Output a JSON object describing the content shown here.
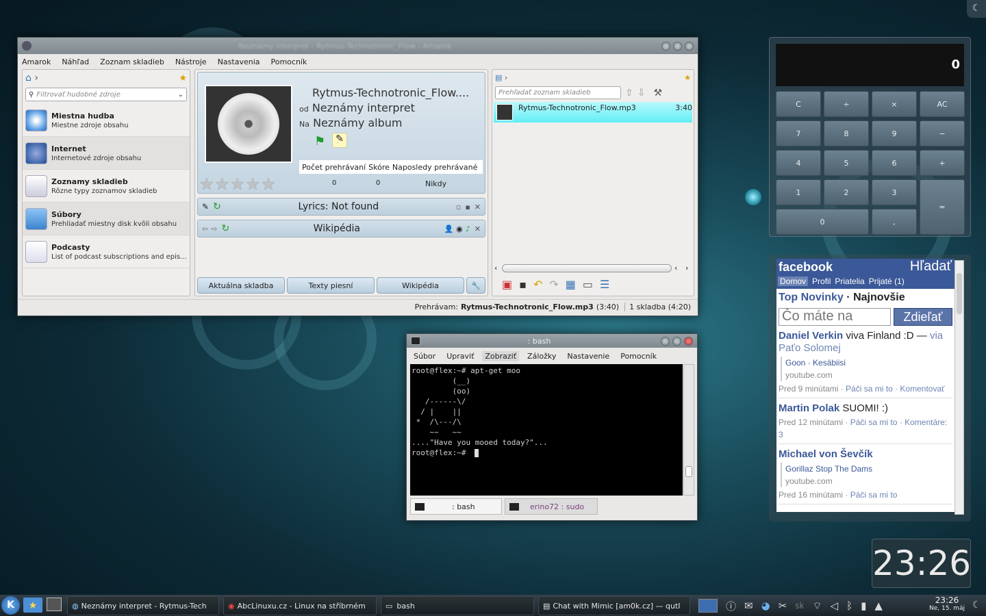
{
  "amarok": {
    "title": "Neznámy interpret - Rytmus-Technotronic_Flow - Amarok",
    "menu": [
      "Amarok",
      "Náhľad",
      "Zoznam skladieb",
      "Nástroje",
      "Nastavenia",
      "Pomocník"
    ],
    "filter_placeholder": "Filtrovať hudobné zdroje",
    "sources": [
      {
        "title": "Miestna hudba",
        "sub": "Miestne zdroje obsahu",
        "icon": "cd-icon"
      },
      {
        "title": "Internet",
        "sub": "Internetové zdroje obsahu",
        "icon": "globe-icon"
      },
      {
        "title": "Zoznamy skladieb",
        "sub": "Rôzne typy zoznamov skladieb",
        "icon": "playlist-icon"
      },
      {
        "title": "Súbory",
        "sub": "Prehliadať miestny disk kvôli obsahu",
        "icon": "folder-icon"
      },
      {
        "title": "Podcasty",
        "sub": "List of podcast subscriptions and epis...",
        "icon": "podcast-icon"
      }
    ],
    "now_playing": {
      "track": "Rytmus-Technotronic_Flow....",
      "by_prefix": "od",
      "artist": "Neznámy interpret",
      "on_prefix": "Na",
      "album": "Neznámy album",
      "stats_headers": [
        "Počet prehrávaní",
        "Skóre",
        "Naposledy prehrávané"
      ],
      "play_count": "0",
      "score": "0",
      "last_played": "Nikdy",
      "rating": 0
    },
    "lyrics_label": "Lyrics: Not found",
    "wiki_label": "Wikipédia",
    "context_tabs": [
      "Aktuálna skladba",
      "Texty piesní",
      "Wikipédia"
    ],
    "playlist_search": "Prehľadať zoznam skladieb",
    "playlist": [
      {
        "name": "Rytmus-Technotronic_Flow.mp3",
        "len": "3:40"
      }
    ],
    "status_prefix": "Prehrávam:",
    "status_track": "Rytmus-Technotronic_Flow.mp3",
    "status_len": "(3:40)",
    "status_count": "1 skladba (4:20)"
  },
  "konsole": {
    "title": ": bash",
    "menu": [
      "Súbor",
      "Upraviť",
      "Zobraziť",
      "Záložky",
      "Nastavenie",
      "Pomocník"
    ],
    "lines": [
      "root@flex:~# apt-get moo",
      "         (__)",
      "         (oo)",
      "   /------\\/",
      "  / |    ||",
      " *  /\\---/\\",
      "    ~~   ~~",
      "....\"Have you mooed today?\"...",
      "root@flex:~# "
    ],
    "tabs": [
      ": bash",
      "erino72 : sudo"
    ]
  },
  "calculator": {
    "display": "0",
    "keys": [
      [
        "C",
        "÷",
        "×",
        "AC"
      ],
      [
        "7",
        "8",
        "9",
        "−"
      ],
      [
        "4",
        "5",
        "6",
        "+"
      ],
      [
        "1",
        "2",
        "3",
        "="
      ],
      [
        "0",
        ","
      ]
    ]
  },
  "facebook": {
    "logo": "facebook",
    "search": "Hľadať",
    "nav": [
      "Domov",
      "Profil",
      "Priatelia",
      "Prijaté (1)"
    ],
    "feed_title": "Top Novinky",
    "feed_sep": "·",
    "feed_alt": "Najnovšie",
    "status_placeholder": "Čo máte na",
    "share": "Zdieľať",
    "posts": [
      {
        "author": "Daniel Verkin",
        "text": "viva Finland :D —",
        "via": "via Paťo Solomej",
        "link": "Goon · Kesäbiisi",
        "domain": "youtube.com",
        "time": "Pred 9 minútami",
        "like": "Páči sa mi to",
        "comment": "Komentovať"
      },
      {
        "author": "Martin Polak",
        "text": "SUOMI! :)",
        "time": "Pred 12 minútami",
        "like": "Páči sa mi to",
        "comment": "Komentáre: 3"
      },
      {
        "author": "Michael von Ševčík",
        "link": "Gorillaz Stop The Dams",
        "domain": "youtube.com",
        "time": "Pred 16 minútami",
        "like": "Páči sa mi to"
      }
    ]
  },
  "clock": "23:26",
  "taskbar": {
    "tasks": [
      "Neznámy interpret - Rytmus-Tech",
      "AbcLinuxu.cz - Linux na stříbrném",
      "bash",
      "Chat with Mimic [am0k.cz] — qutI"
    ],
    "time": "23:26",
    "date": "Ne, 15. máj"
  }
}
